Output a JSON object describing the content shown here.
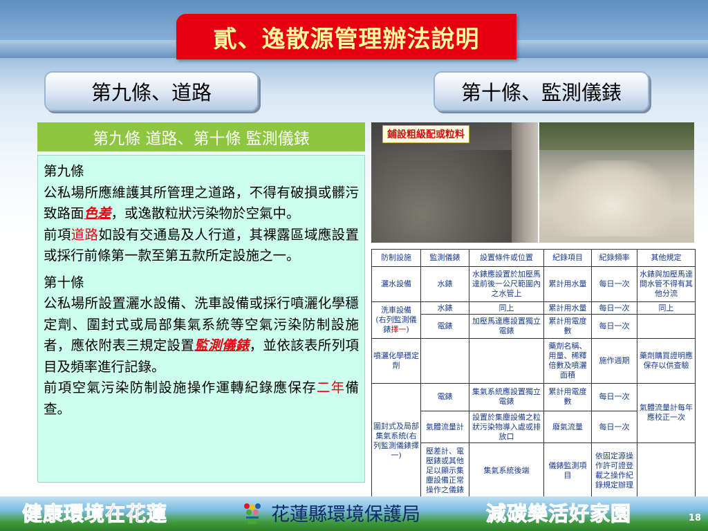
{
  "title": "貳、逸散源管理辦法說明",
  "tabs": {
    "left": "第九條、道路",
    "right": "第十條、監測儀錶"
  },
  "panel": {
    "header": "第九條  道路、第十條  監測儀錶",
    "art9_heading": "第九條",
    "art9_p1_a": "公私場所應維護其所管理之道路，不得有破損或髒污致路面",
    "art9_p1_hl": "色差",
    "art9_p1_b": "，或逸散粒狀污染物於空氣中。",
    "art9_p2_a": "前項",
    "art9_p2_hl": "道路",
    "art9_p2_b": "如設有交通島及人行道，其裸露區域應設置或採行前條第一款至第五款所定設施之一。",
    "art10_heading": "第十條",
    "art10_p1_a": "公私場所設置灑水設備、洗車設備或採行噴灑化學穩定劑、圍封式或局部集氣系統等空氣污染防制設施者，應依附表三規定設置",
    "art10_p1_hl": "監測儀錶",
    "art10_p1_b": "，並依該表所列項目及頻率進行記錄。",
    "art10_p2_a": "前項空氣污染防制設施操作運轉紀錄應保存",
    "art10_p2_hl": "二年",
    "art10_p2_b": "備查。"
  },
  "photo_label": "鋪設粗級配或粒料",
  "table": {
    "headers": [
      "防制設施",
      "監測儀錶",
      "設置條件或位置",
      "紀錄項目",
      "紀錄頻率",
      "其他規定"
    ],
    "r1": [
      "灑水設備",
      "水錶",
      "水錶應設置於加壓馬達前後一公尺範圍內之水管上",
      "累計用水量",
      "每日一次",
      "水錶與加壓馬達間水管不得有其他分流"
    ],
    "r2": [
      "洗車設備",
      "水錶",
      "同上",
      "累計用水量",
      "每日一次",
      "同上"
    ],
    "r2_note_a": "(右列監測儀錶",
    "r2_note_hl": "擇一",
    "r2_note_b": ")",
    "r3": [
      "電錶",
      "加壓馬達應設置獨立電錶",
      "累計用電度數",
      "每日一次"
    ],
    "r4": [
      "噴灑化學穩定劑",
      "藥劑名稱、用量、稀釋倍數及噴灑面積",
      "施作週期",
      "藥劑購買證明應保存以供查驗"
    ],
    "r5_facility": "圍封式及局部集氣系統(右列監測儀錶擇一)",
    "r5": [
      "電錶",
      "集氣系統應設置獨立電錶",
      "累計用電度數",
      "每日一次"
    ],
    "r5_other": "氣體流量計每年應校正一次",
    "r6": [
      "氣體流量計",
      "設置於集塵設備之粒狀污染物導入處或排放口",
      "廢氣流量",
      "每日一次"
    ],
    "r7": [
      "壓差計、電壓錶或其他足以顯示集塵設備正常操作之儀錶",
      "集氣系統後端",
      "儀錶監測項目",
      "依固定源操作許可證登載之操作紀錄規定辦理"
    ]
  },
  "footer": {
    "slogan_left": [
      "健康",
      "環境",
      "在花蓮"
    ],
    "agency": "花蓮縣環境保護局",
    "slogan_right": [
      "減碳",
      "樂",
      "活",
      "好家園"
    ],
    "page": "18"
  },
  "colors": {
    "title_bg": "#e60012",
    "title_text": "#fffe9e",
    "panel_header_bg": "#8dc63f",
    "panel_bg": "#ccffee",
    "highlight": "#e60012",
    "table_text": "#1a3c8c"
  }
}
